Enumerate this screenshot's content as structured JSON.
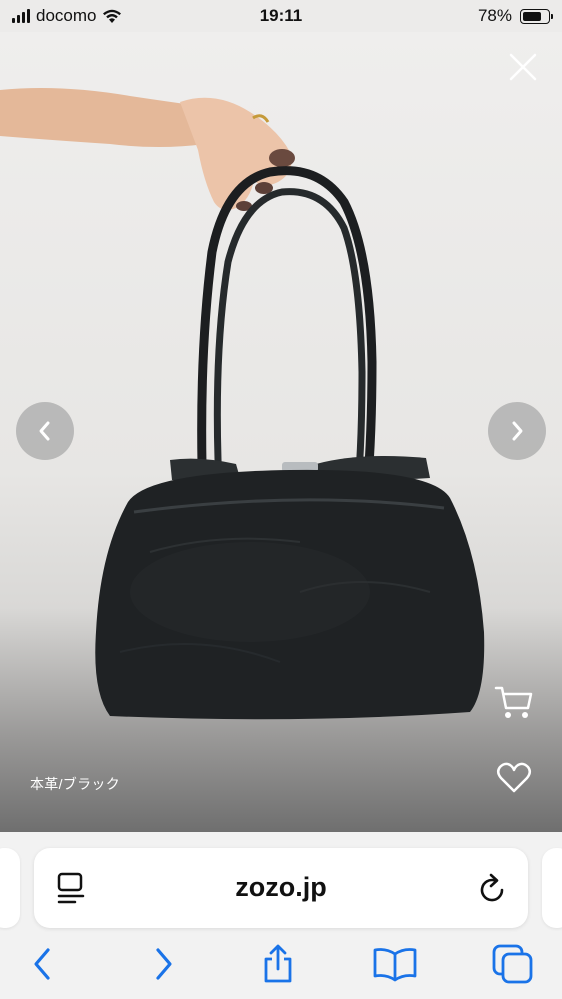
{
  "status_bar": {
    "carrier": "docomo",
    "time": "19:11",
    "battery_percent": "78%",
    "battery_level": 0.78,
    "signal_icon": "cellular-signal-icon",
    "wifi_icon": "wifi-icon"
  },
  "viewer": {
    "caption": "本革/ブラック",
    "close_icon": "close-icon",
    "prev_icon": "chevron-left-icon",
    "next_icon": "chevron-right-icon",
    "cart_icon": "cart-icon",
    "favorite_icon": "heart-icon"
  },
  "safari": {
    "url": "zozo.jp",
    "reader_icon": "reader-mode-icon",
    "reload_icon": "reload-icon",
    "toolbar": {
      "back_icon": "back-arrow-icon",
      "forward_icon": "forward-arrow-icon",
      "share_icon": "share-icon",
      "bookmarks_icon": "bookmarks-icon",
      "tabs_icon": "tabs-icon"
    }
  },
  "colors": {
    "accent": "#1a73e8",
    "bag": "#1f2224",
    "skin": "#e8bfa4"
  }
}
